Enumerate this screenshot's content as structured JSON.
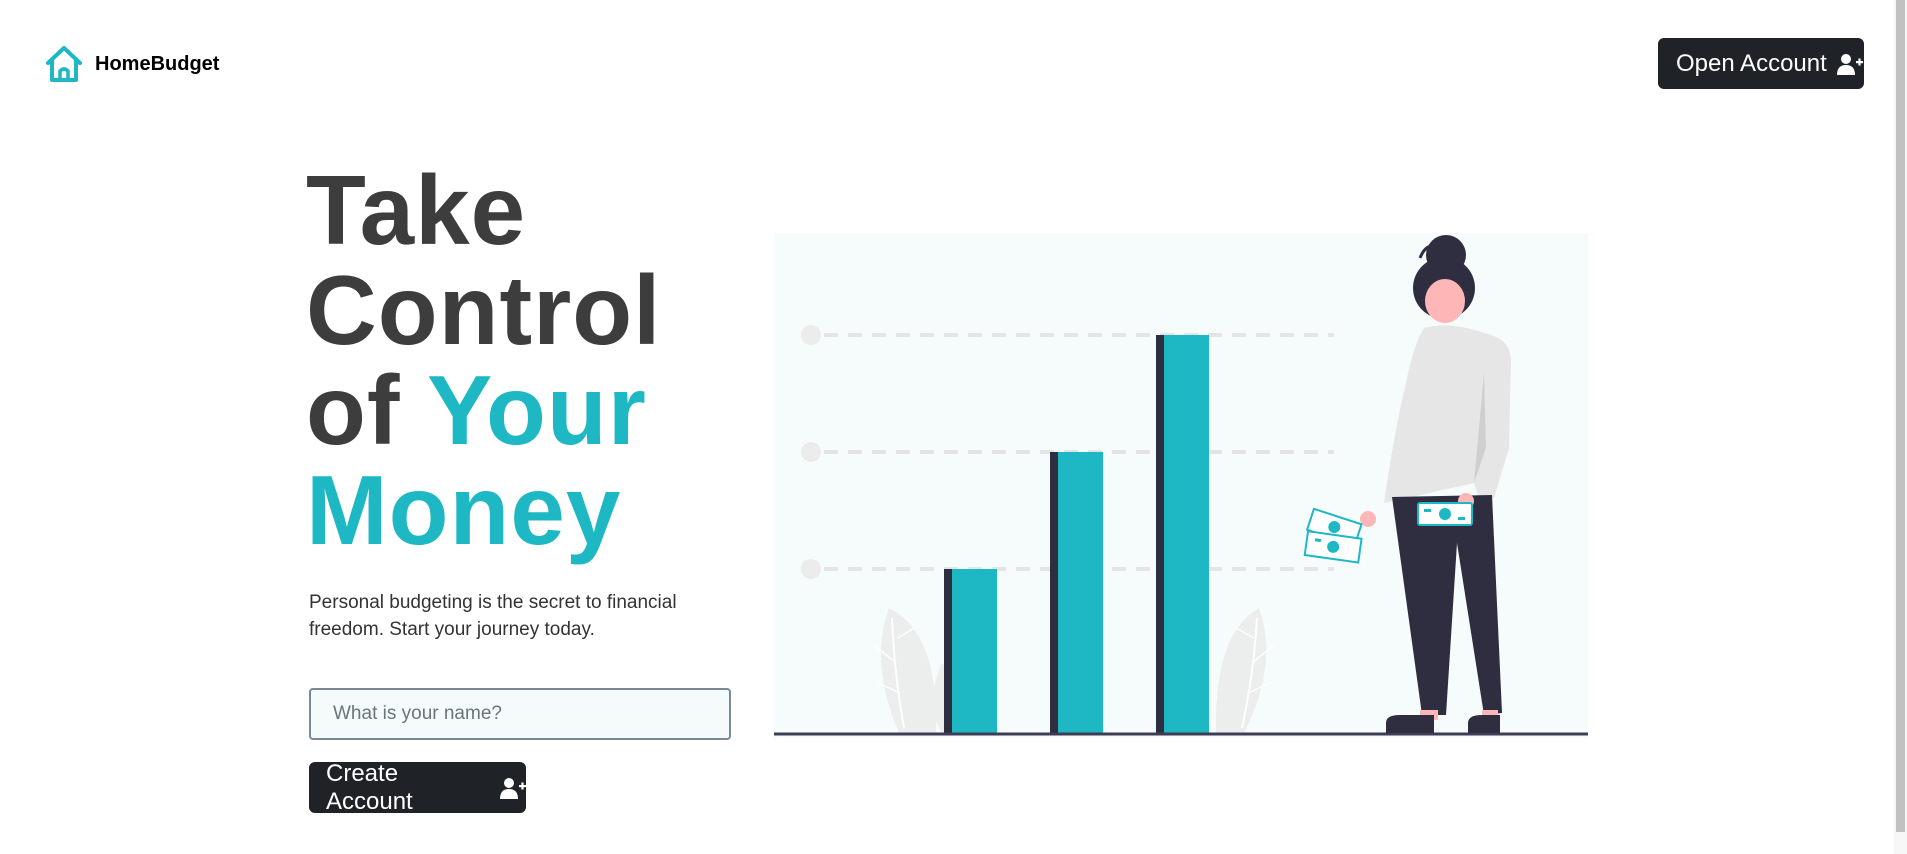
{
  "brand": {
    "name": "HomeBudget",
    "icon": "home-icon",
    "accent_color": "#1eb8c4"
  },
  "nav": {
    "open_account_label": "Open Account",
    "open_account_icon": "user-plus-icon"
  },
  "hero": {
    "title_line1": "Take",
    "title_line2": "Control",
    "title_line3_prefix": "of",
    "title_line3_accent": "Your",
    "title_line4_accent": "Money",
    "subtitle": "Personal budgeting is the secret to financial freedom. Start your journey today.",
    "name_placeholder": "What is your name?",
    "name_value": "",
    "create_account_label": "Create Account",
    "create_account_icon": "user-plus-icon"
  },
  "colors": {
    "accent": "#1eb8c4",
    "dark": "#1f2226",
    "text": "#3d3d3d"
  }
}
